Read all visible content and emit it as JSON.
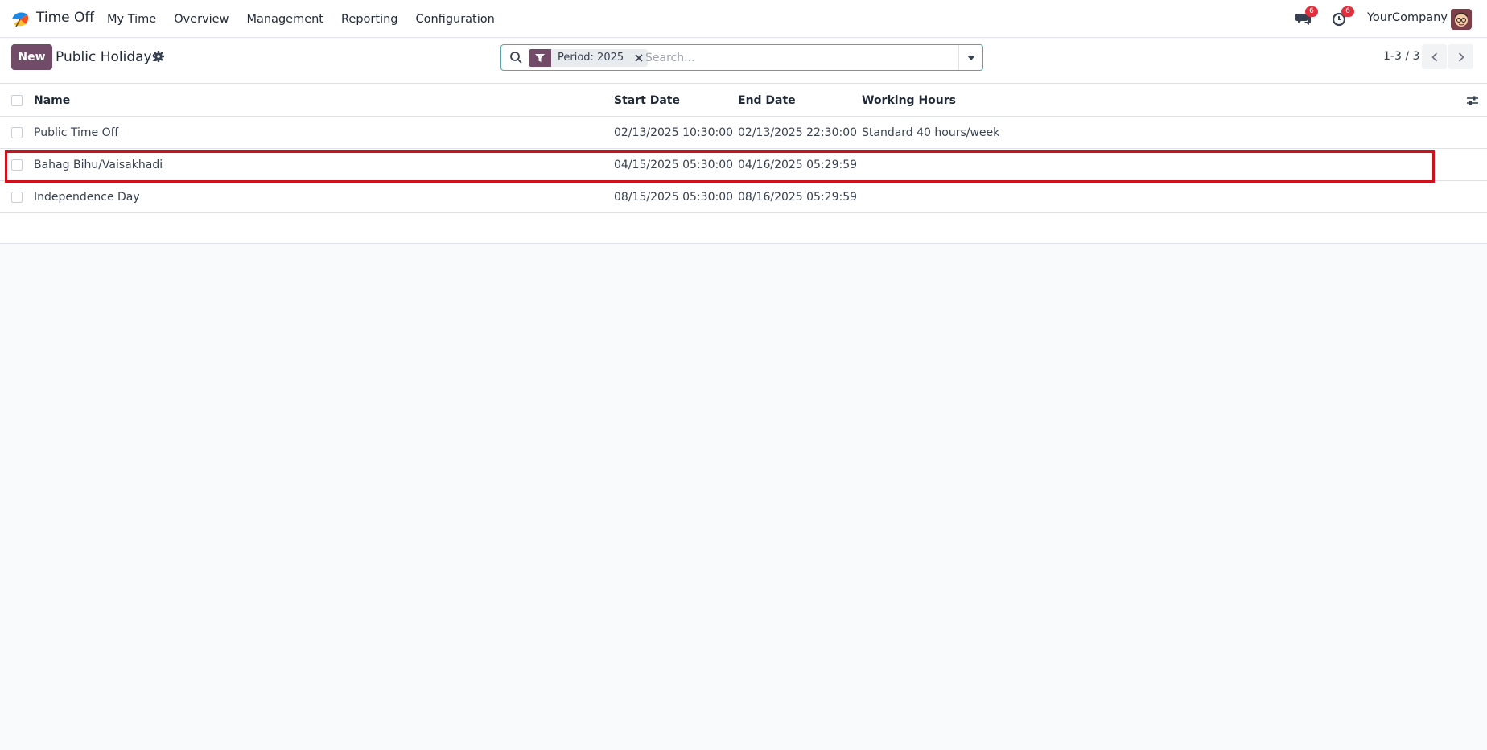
{
  "navbar": {
    "app_name": "Time Off",
    "menu": [
      "My Time",
      "Overview",
      "Management",
      "Reporting",
      "Configuration"
    ],
    "messages_count": "6",
    "activities_count": "6",
    "company": "YourCompany"
  },
  "control": {
    "new_label": "New",
    "title": "Public Holidays",
    "facet_label": "Period: 2025",
    "search_placeholder": "Search...",
    "pager": "1-3 / 3"
  },
  "table": {
    "columns": {
      "name": "Name",
      "start": "Start Date",
      "end": "End Date",
      "hours": "Working Hours"
    },
    "rows": [
      {
        "name": "Public Time Off",
        "start": "02/13/2025 10:30:00",
        "end": "02/13/2025 22:30:00",
        "hours": "Standard 40 hours/week"
      },
      {
        "name": "Bahag Bihu/Vaisakhadi",
        "start": "04/15/2025 05:30:00",
        "end": "04/16/2025 05:29:59",
        "hours": ""
      },
      {
        "name": "Independence Day",
        "start": "08/15/2025 05:30:00",
        "end": "08/16/2025 05:29:59",
        "hours": ""
      }
    ]
  },
  "colors": {
    "brand": "#714b67",
    "badge": "#e0303e",
    "highlight": "#d0101a"
  }
}
